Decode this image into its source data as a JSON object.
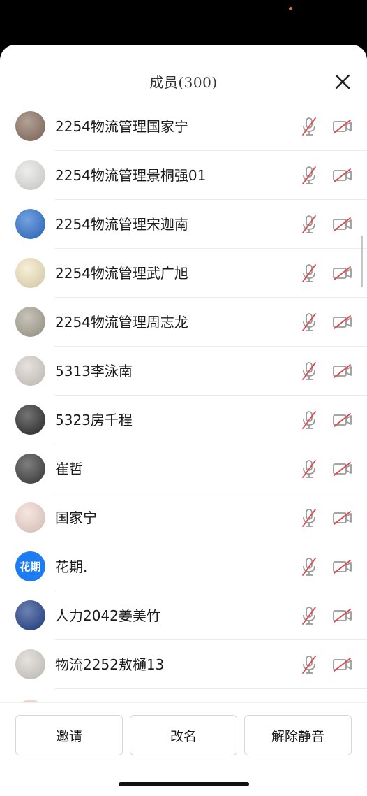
{
  "header": {
    "title": "成员(300)"
  },
  "members": [
    {
      "name": "2254物流管理国家宁",
      "avatar": "photo",
      "avatar_bg": "#8a6f5e"
    },
    {
      "name": "2254物流管理景桐强01",
      "avatar": "photo",
      "avatar_bg": "#e4e4e2"
    },
    {
      "name": "2254物流管理宋迦南",
      "avatar": "photo",
      "avatar_bg": "#2b6fcf"
    },
    {
      "name": "2254物流管理武广旭",
      "avatar": "photo",
      "avatar_bg": "#f3e6c0"
    },
    {
      "name": "2254物流管理周志龙",
      "avatar": "photo",
      "avatar_bg": "#a8a393"
    },
    {
      "name": "5313李泳南",
      "avatar": "photo",
      "avatar_bg": "#d9d2cb"
    },
    {
      "name": "5323房千程",
      "avatar": "photo",
      "avatar_bg": "#2a2a2a"
    },
    {
      "name": "崔哲",
      "avatar": "photo",
      "avatar_bg": "#3a3a3a"
    },
    {
      "name": "国家宁",
      "avatar": "photo",
      "avatar_bg": "#f2d9cf"
    },
    {
      "name": "花期.",
      "avatar": "text",
      "avatar_text": "花期",
      "avatar_bg": "#1d7cf2"
    },
    {
      "name": "人力2042姜美竹",
      "avatar": "photo",
      "avatar_bg": "#1f3f8a"
    },
    {
      "name": "物流2252敖樋13",
      "avatar": "photo",
      "avatar_bg": "#d8d3cd"
    }
  ],
  "footer": {
    "invite_label": "邀请",
    "rename_label": "改名",
    "unmute_label": "解除静音"
  },
  "colors": {
    "muted_red": "#e0464a",
    "icon_gray": "#9a9a9a",
    "accent_blue": "#1d7cf2"
  }
}
